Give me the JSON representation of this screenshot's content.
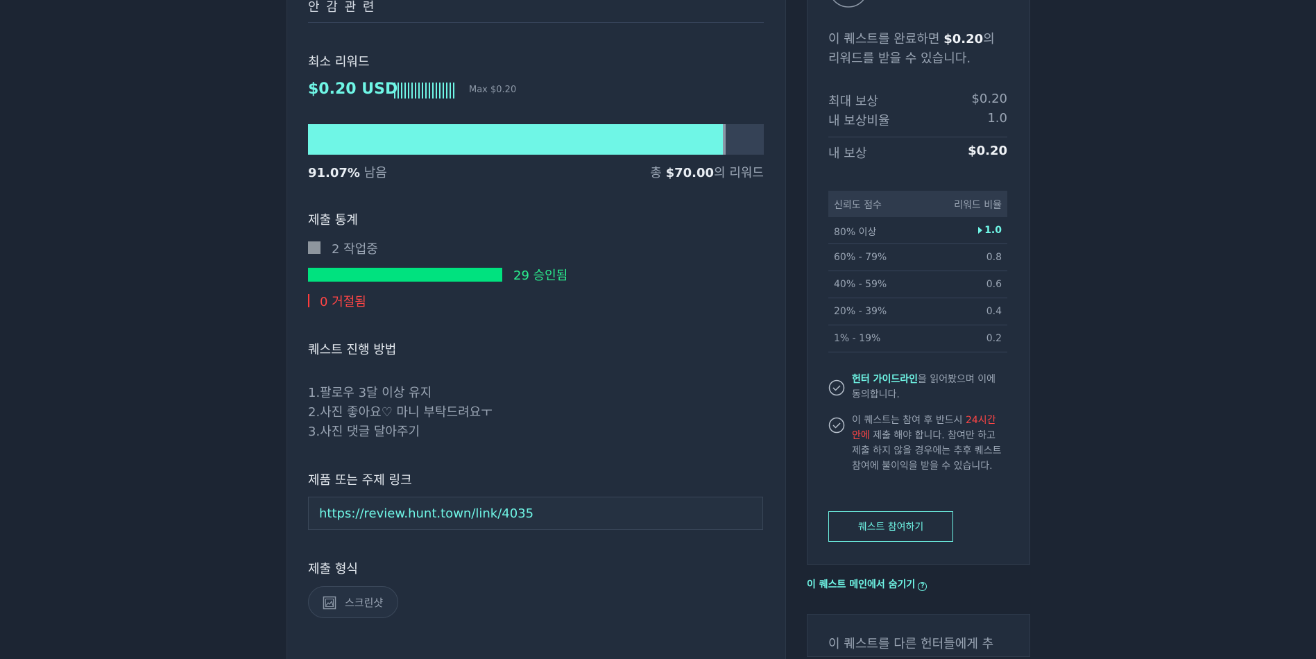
{
  "header": {
    "title_partial": "안 감 관 련"
  },
  "reward": {
    "section_title": "최소 리워드",
    "price": "$0.20 USD",
    "max_text": "Max $0.20",
    "tick_count": 18,
    "progress_remaining_fraction": 0.9107,
    "remaining_percent": "91.07%",
    "remaining_suffix": " 남음",
    "total_prefix": "총 ",
    "total_value": "$70.00",
    "total_suffix": "의 리워드"
  },
  "stats": {
    "section_title": "제출 통계",
    "working": "2 작업중",
    "approved": "29 승인됨",
    "rejected": "0 거절됨"
  },
  "how_to": {
    "section_title": "퀘스트 진행 방법",
    "lines": [
      "1.팔로우 3달 이상 유지",
      "2.사진 좋아요♡ 마니 부탁드려요ㅜ",
      "3.사진 댓글 달아주기"
    ]
  },
  "link": {
    "section_title": "제품 또는 주제 링크",
    "url": "https://review.hunt.town/link/4035"
  },
  "submission": {
    "section_title": "제출 형식",
    "format_label": "스크린샷"
  },
  "sidebar": {
    "desc_prefix": "이 퀘스트를 완료하면 ",
    "desc_amount": "$0.20",
    "desc_mid": "의",
    "desc_suffix": "리워드를 받을 수 있습니다.",
    "max_reward_label": "최대 보상",
    "max_reward_value": "$0.20",
    "my_ratio_label": "내 보상비율",
    "my_ratio_value": "1.0",
    "my_reward_label": "내 보상",
    "my_reward_value": "$0.20",
    "table": {
      "head_left": "신뢰도 점수",
      "head_right": "리워드 비율",
      "rows": [
        {
          "range": "80% 이상",
          "ratio": "1.0"
        },
        {
          "range": "60% - 79%",
          "ratio": "0.8"
        },
        {
          "range": "40% - 59%",
          "ratio": "0.6"
        },
        {
          "range": "20% - 39%",
          "ratio": "0.4"
        },
        {
          "range": "1% - 19%",
          "ratio": "0.2"
        }
      ]
    },
    "check1_link": "헌터 가이드라인",
    "check1_rest": "을 읽어봤으며 이에 동의합니다.",
    "check2_a": "이 퀘스트는 참여 후 반드시 ",
    "check2_red": "24시간 안에",
    "check2_b": " 제출 해야 합니다. 참여만 하고 제출 하지 않을 경우에는 추후 퀘스트 참여에 불이익을 받을 수 있습니다.",
    "join_button": "퀘스트 참여하기",
    "hide_link": "이 퀘스트 메인에서 숨기기",
    "hide_help": "?",
    "bottom_text": "이 퀘스트를 다른 헌터들에게 추"
  },
  "colors": {
    "accent": "#6ff6e6",
    "approved": "#00e27f",
    "rejected": "#ff3b3b",
    "background": "#1c2533",
    "card": "#222d3d"
  }
}
